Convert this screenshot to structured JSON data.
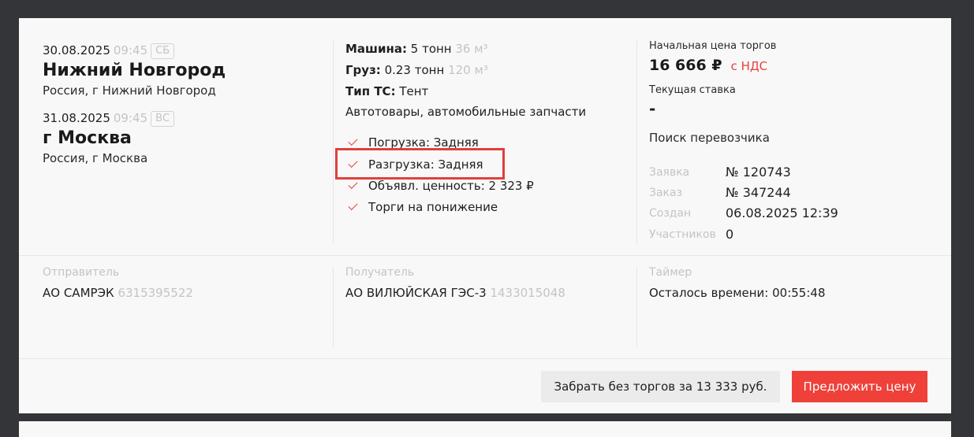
{
  "pickup": {
    "date": "30.08.2025",
    "time": "09:45",
    "day": "СБ",
    "city": "Нижний Новгород",
    "address": "Россия, г Нижний Новгород"
  },
  "delivery": {
    "date": "31.08.2025",
    "time": "09:45",
    "day": "ВС",
    "city": "г Москва",
    "address": "Россия, г Москва"
  },
  "specs": {
    "vehicle_label": "Машина:",
    "vehicle_value": "5 тонн",
    "vehicle_volume": "36 м³",
    "cargo_label": "Груз:",
    "cargo_value": "0.23 тонн",
    "cargo_volume": "120 м³",
    "ts_type_label": "Тип ТС:",
    "ts_type_value": "Тент",
    "goods": "Автотовары, автомобильные запчасти"
  },
  "features": [
    "Погрузка: Задняя",
    "Разгрузка: Задняя",
    "Объявл. ценность: 2 323 ₽",
    "Торги на понижение"
  ],
  "pricing": {
    "start_label": "Начальная цена торгов",
    "start_price": "16 666 ₽",
    "vat": "с НДС",
    "current_label": "Текущая ставка",
    "current_value": "-",
    "status": "Поиск перевозчика"
  },
  "meta": [
    {
      "key": "Заявка",
      "value": "№ 120743"
    },
    {
      "key": "Заказ",
      "value": "№ 347244"
    },
    {
      "key": "Создан",
      "value": "06.08.2025 12:39"
    },
    {
      "key": "Участников",
      "value": "0"
    }
  ],
  "sender": {
    "label": "Отправитель",
    "name": "АО САМРЭК",
    "inn": "6315395522"
  },
  "receiver": {
    "label": "Получатель",
    "name": "АО ВИЛЮЙСКАЯ ГЭС-3",
    "inn": "1433015048"
  },
  "timer": {
    "label": "Таймер",
    "text": "Осталось времени: 00:55:48"
  },
  "actions": {
    "take_label": "Забрать без торгов за 13 333 руб.",
    "offer_label": "Предложить цену"
  },
  "colors": {
    "accent": "#ef403a",
    "muted": "#c4c4c4",
    "background": "#343538",
    "card": "#f8f8f8"
  }
}
